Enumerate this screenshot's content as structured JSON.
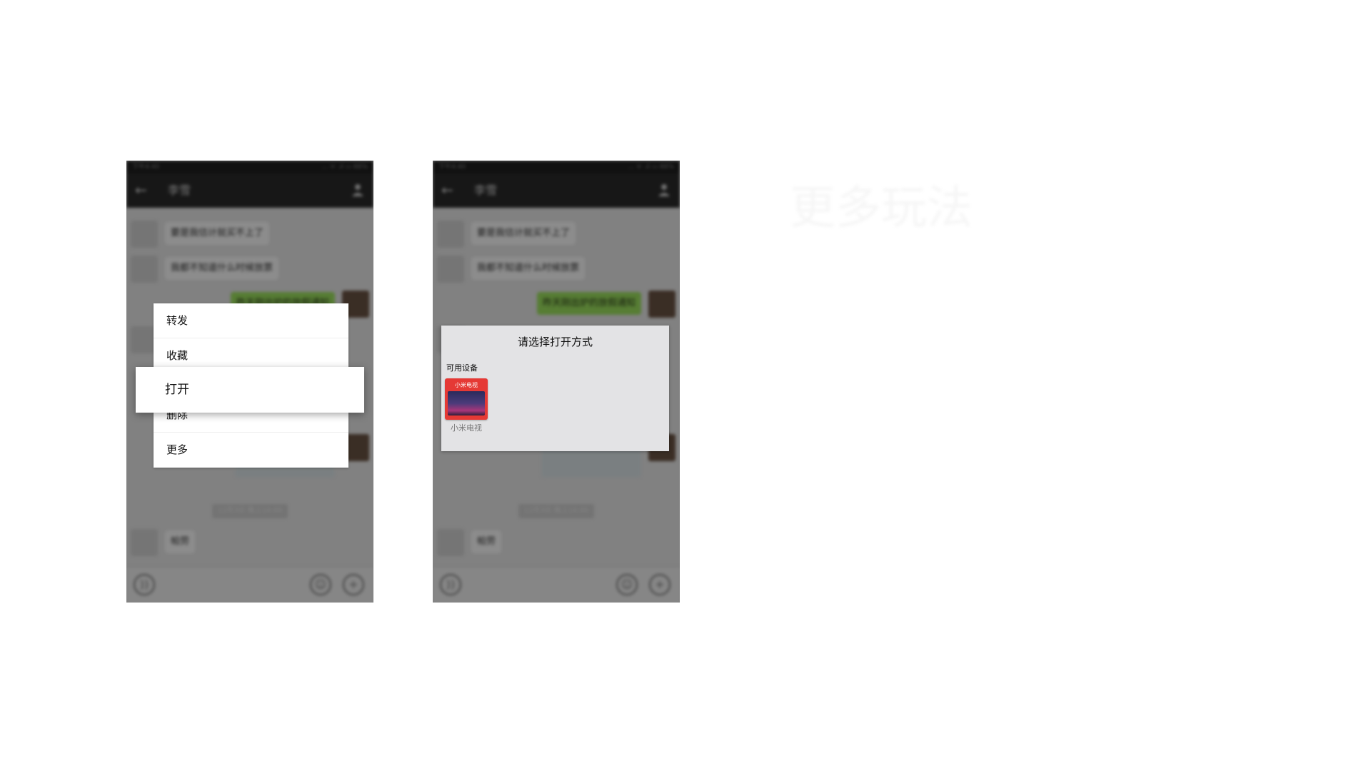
{
  "status_bar": {
    "time": "下午4:40",
    "indicators": "... ᯤ .ıl ▭ 66%"
  },
  "chat": {
    "contact_name": "李雪",
    "messages": [
      {
        "text": "要是我估计就买不上了",
        "side": "left"
      },
      {
        "text": "我都不知道什么时候放票",
        "side": "left"
      },
      {
        "text": "昨天刚出炉的放假通知",
        "side": "right"
      },
      {
        "text": "帕劳",
        "side": "left"
      }
    ],
    "timestamp": "12月3日 晚上10:00"
  },
  "context_menu": {
    "items": [
      "转发",
      "收藏",
      "打开",
      "删除",
      "更多"
    ],
    "highlighted": "打开"
  },
  "open_with_dialog": {
    "title": "请选择打开方式",
    "section_label": "可用设备",
    "device": {
      "name": "小米电视",
      "brand_label": "小米电视",
      "color": "#e53935"
    }
  },
  "side_heading": "更多玩法",
  "icons": [
    "back-arrow-icon",
    "contact-icon",
    "voice-icon",
    "emoji-icon",
    "plus-icon"
  ]
}
